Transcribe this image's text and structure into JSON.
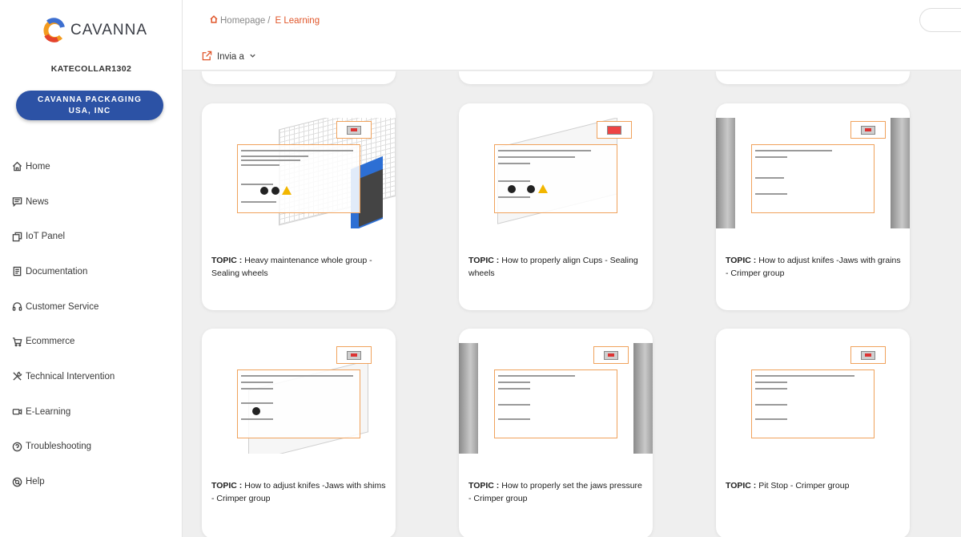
{
  "sidebar": {
    "logo_text": "CAVANNA",
    "username": "KATECOLLAR1302",
    "company_button": "CAVANNA PACKAGING USA, INC",
    "nav": [
      {
        "label": "Home",
        "icon": "home-icon"
      },
      {
        "label": "News",
        "icon": "news-icon"
      },
      {
        "label": "IoT Panel",
        "icon": "iot-panel-icon"
      },
      {
        "label": "Documentation",
        "icon": "document-icon"
      },
      {
        "label": "Customer Service",
        "icon": "headset-icon"
      },
      {
        "label": "Ecommerce",
        "icon": "cart-icon"
      },
      {
        "label": "Technical Intervention",
        "icon": "tools-icon"
      },
      {
        "label": "E-Learning",
        "icon": "video-icon"
      },
      {
        "label": "Troubleshooting",
        "icon": "question-icon"
      },
      {
        "label": "Help",
        "icon": "help-icon"
      }
    ]
  },
  "header": {
    "breadcrumb_home": "Homepage",
    "breadcrumb_sep": "/",
    "breadcrumb_current": "E Learning",
    "send_to_label": "Invia a"
  },
  "cards": [
    {
      "topic_prefix": "TOPIC :",
      "topic": "Heavy maintenance whole group - Sealing wheels"
    },
    {
      "topic_prefix": "TOPIC :",
      "topic": "How to properly align Cups - Sealing wheels"
    },
    {
      "topic_prefix": "TOPIC :",
      "topic": "How to adjust knifes -Jaws with grains - Crimper group"
    },
    {
      "topic_prefix": "TOPIC :",
      "topic": "How to adjust knifes -Jaws with shims - Crimper group"
    },
    {
      "topic_prefix": "TOPIC :",
      "topic": "How to properly set the jaws pressure - Crimper group"
    },
    {
      "topic_prefix": "TOPIC :",
      "topic": "Pit Stop - Crimper group"
    }
  ],
  "colors": {
    "accent": "#e0562a",
    "brand_blue": "#2c52a5",
    "thumb_border": "#f0a25c"
  }
}
